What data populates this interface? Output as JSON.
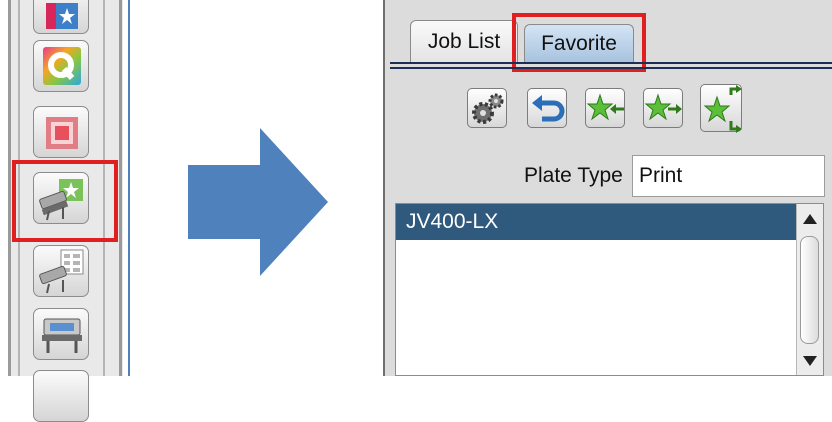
{
  "toolbar": {
    "buttons": [
      {
        "icon": "favorite-star-icon"
      },
      {
        "icon": "q-app-icon"
      },
      {
        "icon": "frame-icon"
      },
      {
        "icon": "printer-favorite-icon"
      },
      {
        "icon": "printer-list-icon"
      },
      {
        "icon": "plotter-icon"
      }
    ],
    "highlighted_button": "printer-favorite-icon"
  },
  "arrow": {
    "direction": "right",
    "color": "#4f81bd"
  },
  "panel": {
    "tabs": [
      {
        "label": "Job List",
        "active": false
      },
      {
        "label": "Favorite",
        "active": true
      }
    ],
    "tool_icons": [
      "settings-gear-icon",
      "undo-icon",
      "import-favorite-icon",
      "export-favorite-icon",
      "split-favorite-icon"
    ],
    "plate_type": {
      "label": "Plate Type",
      "value": "Print"
    },
    "list": {
      "items": [
        "JV400-LX"
      ],
      "selected": "JV400-LX"
    }
  },
  "colors": {
    "highlight": "#e02020",
    "selection": "#2f5a7e",
    "star": "#5bbf3a"
  }
}
